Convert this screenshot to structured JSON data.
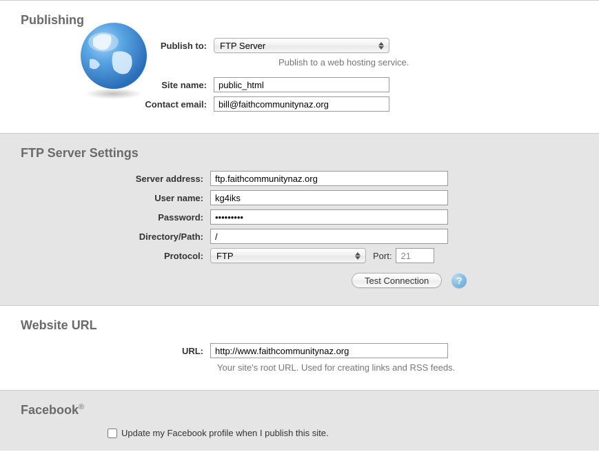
{
  "publishing": {
    "title": "Publishing",
    "publish_to_label": "Publish to:",
    "publish_to_value": "FTP Server",
    "publish_helper": "Publish to a web hosting service.",
    "site_name_label": "Site name:",
    "site_name_value": "public_html",
    "contact_email_label": "Contact email:",
    "contact_email_value": "bill@faithcommunitynaz.org"
  },
  "ftp": {
    "title": "FTP Server Settings",
    "server_address_label": "Server address:",
    "server_address_value": "ftp.faithcommunitynaz.org",
    "user_name_label": "User name:",
    "user_name_value": "kg4iks",
    "password_label": "Password:",
    "password_value": "•••••••••",
    "directory_label": "Directory/Path:",
    "directory_value": "/",
    "protocol_label": "Protocol:",
    "protocol_value": "FTP",
    "port_label": "Port:",
    "port_value": "21",
    "test_button": "Test Connection"
  },
  "url": {
    "title": "Website URL",
    "url_label": "URL:",
    "url_value": "http://www.faithcommunitynaz.org",
    "helper": "Your site's root URL. Used for creating links and RSS feeds."
  },
  "facebook": {
    "title_base": "Facebook",
    "title_sup": "®",
    "checkbox_label": "Update my Facebook profile when I publish this site."
  }
}
